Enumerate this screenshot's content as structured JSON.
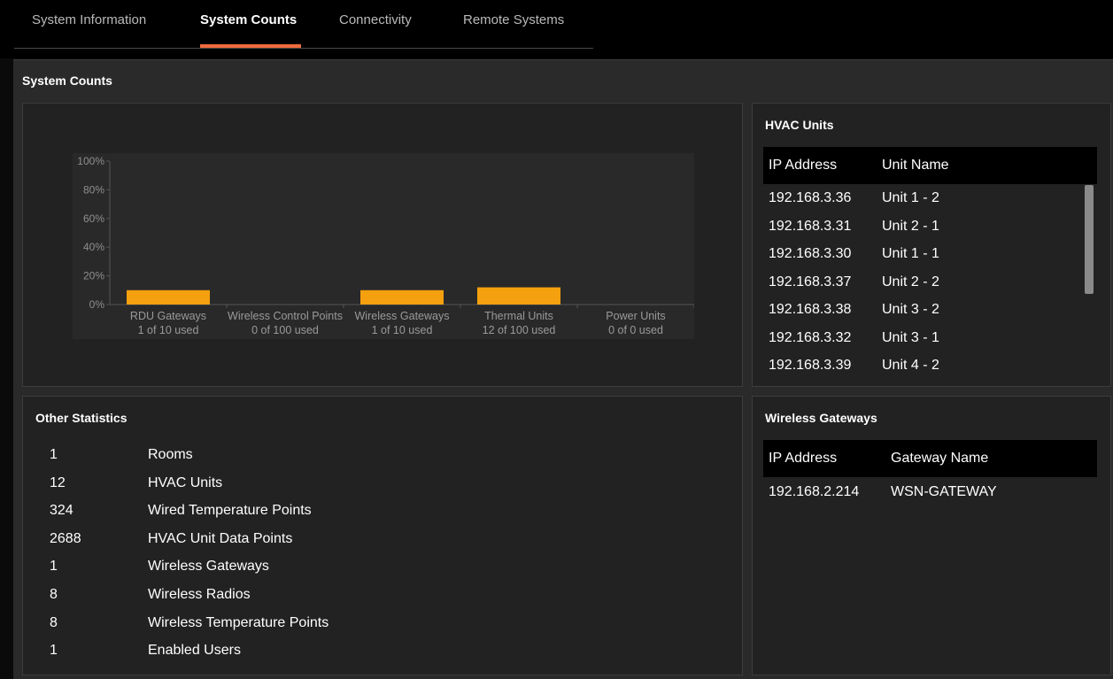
{
  "tabs": [
    {
      "label": "System Information",
      "active": false
    },
    {
      "label": "System Counts",
      "active": true
    },
    {
      "label": "Connectivity",
      "active": false
    },
    {
      "label": "Remote Systems",
      "active": false
    }
  ],
  "colors": {
    "accent": "#ef6a3c",
    "bar": "#f5a00f",
    "background": "#2a2a2a",
    "header_bg": "#000000"
  },
  "section_title": "System Counts",
  "chart_data": {
    "type": "bar",
    "y_ticks": [
      "100%",
      "80%",
      "60%",
      "40%",
      "20%",
      "0%"
    ],
    "ylim": [
      0,
      100
    ],
    "categories": [
      {
        "name": "RDU Gateways",
        "sub": "1 of 10 used"
      },
      {
        "name": "Wireless Control Points",
        "sub": "0 of 100 used"
      },
      {
        "name": "Wireless Gateways",
        "sub": "1 of 10 used"
      },
      {
        "name": "Thermal Units",
        "sub": "12 of 100 used"
      },
      {
        "name": "Power Units",
        "sub": "0 of 0 used"
      }
    ],
    "values": [
      10,
      0,
      10,
      12,
      0
    ],
    "grid": false,
    "legend": false
  },
  "hvac": {
    "title": "HVAC Units",
    "col_ip": "IP Address",
    "col_name": "Unit Name",
    "rows": [
      {
        "ip": "192.168.3.36",
        "name": "Unit 1 - 2"
      },
      {
        "ip": "192.168.3.31",
        "name": "Unit 2 - 1"
      },
      {
        "ip": "192.168.3.30",
        "name": "Unit 1 - 1"
      },
      {
        "ip": "192.168.3.37",
        "name": "Unit 2 - 2"
      },
      {
        "ip": "192.168.3.38",
        "name": "Unit 3 - 2"
      },
      {
        "ip": "192.168.3.32",
        "name": "Unit 3 - 1"
      },
      {
        "ip": "192.168.3.39",
        "name": "Unit 4 - 2"
      }
    ]
  },
  "other_stats": {
    "title": "Other Statistics",
    "rows": [
      {
        "value": "1",
        "label": "Rooms"
      },
      {
        "value": "12",
        "label": "HVAC Units"
      },
      {
        "value": "324",
        "label": "Wired Temperature Points"
      },
      {
        "value": "2688",
        "label": "HVAC Unit Data Points"
      },
      {
        "value": "1",
        "label": "Wireless Gateways"
      },
      {
        "value": "8",
        "label": "Wireless Radios"
      },
      {
        "value": "8",
        "label": "Wireless Temperature Points"
      },
      {
        "value": "1",
        "label": "Enabled Users"
      }
    ]
  },
  "wireless_gateways": {
    "title": "Wireless Gateways",
    "col_ip": "IP Address",
    "col_name": "Gateway Name",
    "rows": [
      {
        "ip": "192.168.2.214",
        "name": "WSN-GATEWAY"
      }
    ]
  }
}
